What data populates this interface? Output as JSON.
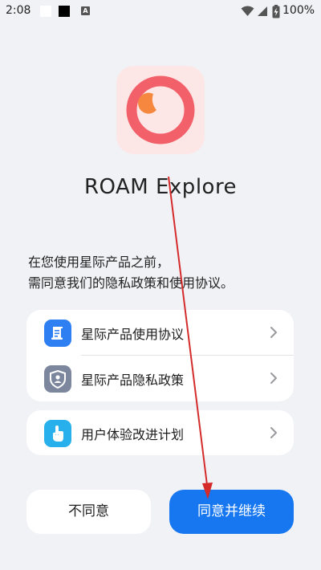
{
  "status_bar": {
    "time": "2:08",
    "battery_percent": "100%",
    "notification_icon_letter": "A",
    "icons": [
      "wifi-icon",
      "signal-icon",
      "battery-charging-icon"
    ]
  },
  "app": {
    "name": "ROAM Explore",
    "logo_colors": {
      "background": "#fde7e6",
      "ring": "#f2606a",
      "dot": "#f5883e"
    }
  },
  "intro": {
    "line1": "在您使用星际产品之前，",
    "line2": "需同意我们的隐私政策和使用协议。"
  },
  "links": [
    {
      "label": "星际产品使用协议",
      "icon": "document-icon",
      "icon_color": "#2e7ff1"
    },
    {
      "label": "星际产品隐私政策",
      "icon": "privacy-shield-icon",
      "icon_color": "#7c869c"
    },
    {
      "label": "用户体验改进计划",
      "icon": "hand-pointer-icon",
      "icon_color": "#27b0ec"
    }
  ],
  "buttons": {
    "disagree": "不同意",
    "agree": "同意并继续",
    "agree_color": "#1677f0"
  },
  "annotation": {
    "arrow_color": "#d42a2a"
  }
}
